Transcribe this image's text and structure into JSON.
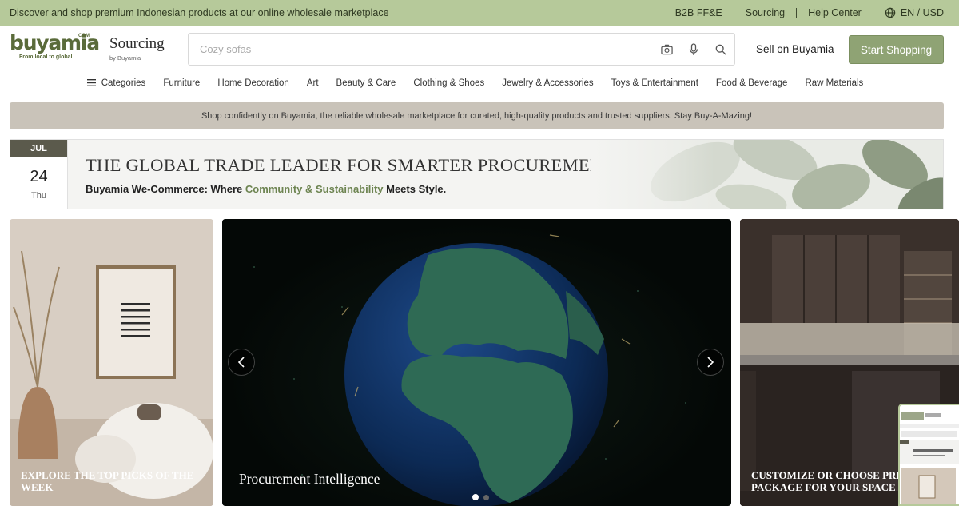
{
  "topbar": {
    "message": "Discover and shop premium Indonesian products at our online wholesale marketplace",
    "links": [
      "B2B FF&E",
      "Sourcing",
      "Help Center"
    ],
    "language": "EN / USD"
  },
  "header": {
    "logo_text": "buyamia",
    "logo_com": "COM",
    "logo_tagline": "From local to global",
    "sourcing_title": "Sourcing",
    "sourcing_sub": "by Buyamia",
    "search_placeholder": "Cozy sofas",
    "sell_label": "Sell on Buyamia",
    "start_label": "Start Shopping"
  },
  "categories": {
    "all_label": "Categories",
    "items": [
      "Furniture",
      "Home Decoration",
      "Art",
      "Beauty & Care",
      "Clothing & Shoes",
      "Jewelry & Accessories",
      "Toys & Entertainment",
      "Food & Beverage",
      "Raw Materials"
    ]
  },
  "banner": {
    "text": "Shop confidently on Buyamia, the reliable wholesale marketplace for curated, high-quality products and trusted suppliers. Stay Buy-A-Mazing!"
  },
  "hero": {
    "month": "JUL",
    "day": "24",
    "weekday": "Thu",
    "headline": "THE GLOBAL TRADE LEADER FOR SMARTER PROCUREMENT",
    "sub_before": "Buyamia We-Commerce: Where ",
    "sub_highlight": "Community & Sustainability",
    "sub_after": " Meets Style."
  },
  "panels": {
    "left_caption": "EXPLORE THE TOP PICKS OF THE WEEK",
    "center_caption": "Procurement Intelligence",
    "right_caption": "CUSTOMIZE OR CHOOSE PRE-M PACKAGE FOR YOUR SPACE"
  },
  "carousel": {
    "slide_count": 2,
    "active_slide": 1
  },
  "colors": {
    "topbar": "#b6c99a",
    "brand": "#5a6b3a",
    "accent": "#8fa374",
    "banner": "#c9c3b9"
  }
}
